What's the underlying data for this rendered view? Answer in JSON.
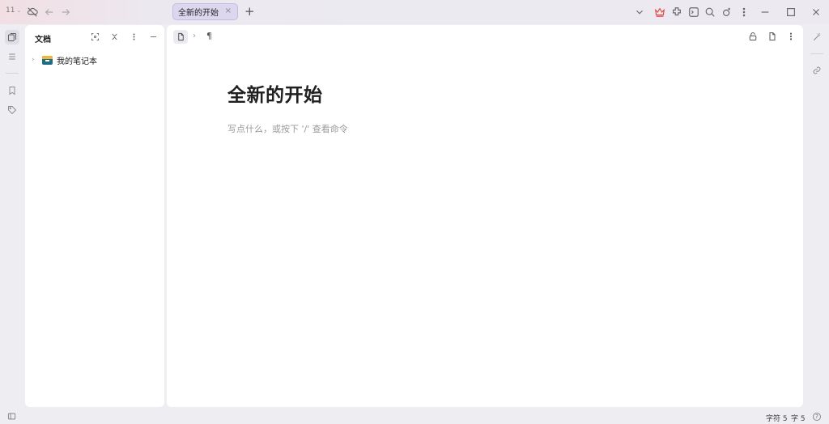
{
  "titlebar": {
    "workspace_number": "11",
    "tab_label": "全新的开始",
    "tab_close": "×",
    "add_tab": "+"
  },
  "files": {
    "heading": "文档",
    "notebooks": [
      {
        "label": "我的笔记本"
      }
    ]
  },
  "editor": {
    "breadcrumb_paragraph": "¶",
    "title": "全新的开始",
    "placeholder": "写点什么，或按下 '/' 查看命令"
  },
  "status": {
    "chars_label": "字符 5",
    "words_label": "字 5",
    "help": "?"
  },
  "icons": {
    "tab_close": "close-icon",
    "vip": "crown-icon"
  },
  "colors": {
    "tab_bg": "#dcd6ee",
    "crown": "#e0453f",
    "notebook_top": "#f2b640",
    "notebook_body": "#1f6d82"
  }
}
